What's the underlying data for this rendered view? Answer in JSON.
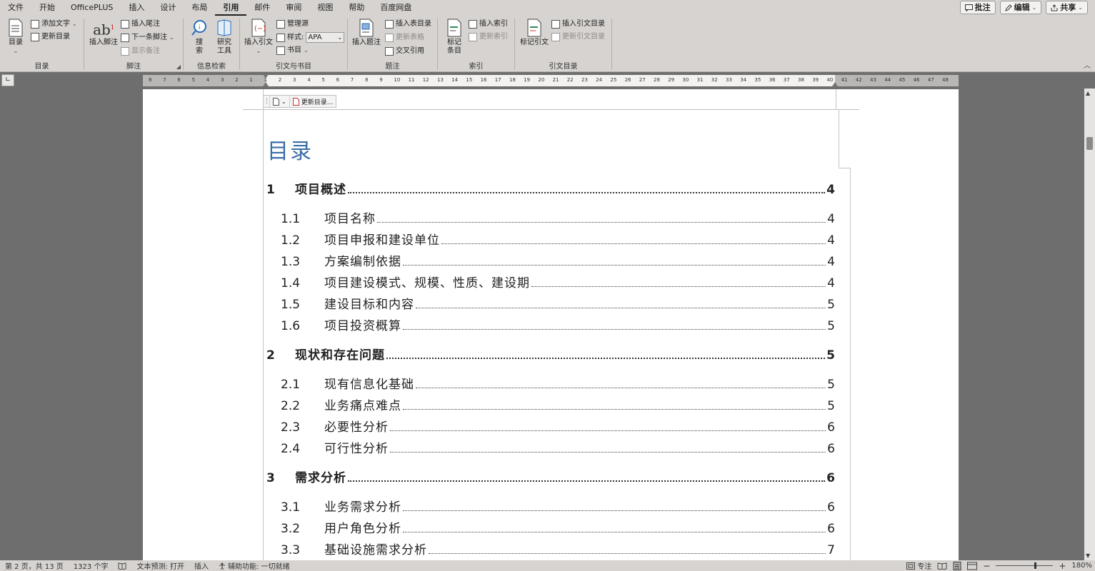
{
  "menu": {
    "items": [
      "文件",
      "开始",
      "OfficePLUS",
      "插入",
      "设计",
      "布局",
      "引用",
      "邮件",
      "审阅",
      "视图",
      "帮助",
      "百度网盘"
    ],
    "active": "引用",
    "comment_btn": "批注",
    "edit_btn": "编辑",
    "share_btn": "共享"
  },
  "ribbon": {
    "toc_group": {
      "label": "目录",
      "toc_btn": "目录",
      "add_text": "添加文字",
      "update_toc": "更新目录"
    },
    "footnote_group": {
      "label": "脚注",
      "insert_footnote": "插入脚注",
      "insert_endnote": "插入尾注",
      "next_footnote": "下一条脚注",
      "show_notes": "显示备注"
    },
    "research_group": {
      "label": "信息检索",
      "search": "搜索",
      "researcher": "研究工具"
    },
    "citation_group": {
      "label": "引文与书目",
      "insert_citation": "插入引文",
      "manage_sources": "管理源",
      "style_label": "样式:",
      "style_value": "APA",
      "bibliography": "书目"
    },
    "caption_group": {
      "label": "题注",
      "insert_caption": "插入题注",
      "insert_table_of_figures": "插入表目录",
      "update_table": "更新表格",
      "cross_reference": "交叉引用"
    },
    "index_group": {
      "label": "索引",
      "mark_entry": "标记条目",
      "insert_index": "插入索引",
      "update_index": "更新索引"
    },
    "authorities_group": {
      "label": "引文目录",
      "mark_citation": "标记引文",
      "insert_toa": "插入引文目录",
      "update_toa": "更新引文目录"
    }
  },
  "ruler": {
    "ticks": [
      "8",
      "7",
      "6",
      "5",
      "4",
      "3",
      "2",
      "1",
      "1",
      "2",
      "3",
      "4",
      "5",
      "6",
      "7",
      "8",
      "9",
      "10",
      "11",
      "12",
      "13",
      "14",
      "15",
      "16",
      "17",
      "18",
      "19",
      "20",
      "21",
      "22",
      "23",
      "24",
      "25",
      "26",
      "27",
      "28",
      "29",
      "30",
      "31",
      "32",
      "33",
      "34",
      "35",
      "36",
      "37",
      "38",
      "39",
      "40",
      "41",
      "42",
      "43",
      "44",
      "45",
      "46",
      "47",
      "48"
    ]
  },
  "document": {
    "cc_update_label": "更新目录...",
    "toc_title": "目录",
    "toc": [
      {
        "level": 1,
        "num": "1",
        "text": "项目概述",
        "page": "4"
      },
      {
        "level": 2,
        "num": "1.1",
        "text": "项目名称",
        "page": "4"
      },
      {
        "level": 2,
        "num": "1.2",
        "text": "项目申报和建设单位",
        "page": "4"
      },
      {
        "level": 2,
        "num": "1.3",
        "text": "方案编制依据",
        "page": "4"
      },
      {
        "level": 2,
        "num": "1.4",
        "text": "项目建设模式、规模、性质、建设期",
        "page": "4"
      },
      {
        "level": 2,
        "num": "1.5",
        "text": "建设目标和内容",
        "page": "5"
      },
      {
        "level": 2,
        "num": "1.6",
        "text": "项目投资概算",
        "page": "5"
      },
      {
        "level": 1,
        "num": "2",
        "text": "现状和存在问题",
        "page": "5"
      },
      {
        "level": 2,
        "num": "2.1",
        "text": "现有信息化基础",
        "page": "5"
      },
      {
        "level": 2,
        "num": "2.2",
        "text": "业务痛点难点",
        "page": "5"
      },
      {
        "level": 2,
        "num": "2.3",
        "text": "必要性分析",
        "page": "6"
      },
      {
        "level": 2,
        "num": "2.4",
        "text": "可行性分析",
        "page": "6"
      },
      {
        "level": 1,
        "num": "3",
        "text": "需求分析",
        "page": "6"
      },
      {
        "level": 2,
        "num": "3.1",
        "text": "业务需求分析",
        "page": "6"
      },
      {
        "level": 2,
        "num": "3.2",
        "text": "用户角色分析",
        "page": "6"
      },
      {
        "level": 2,
        "num": "3.3",
        "text": "基础设施需求分析",
        "page": "7"
      }
    ]
  },
  "status": {
    "page": "第 2 页，共 13 页",
    "words": "1323 个字",
    "text_predict": "文本预测: 打开",
    "insert_mode": "插入",
    "accessibility": "辅助功能: 一切就绪",
    "focus": "专注",
    "zoom_minus": "−",
    "zoom_plus": "+",
    "zoom": "180%",
    "zoom_fraction": 0.68
  },
  "colors": {
    "ribbon_bg": "#d6d3d0",
    "workspace_bg": "#6e6e6e",
    "toc_title": "#3b6ea8"
  }
}
